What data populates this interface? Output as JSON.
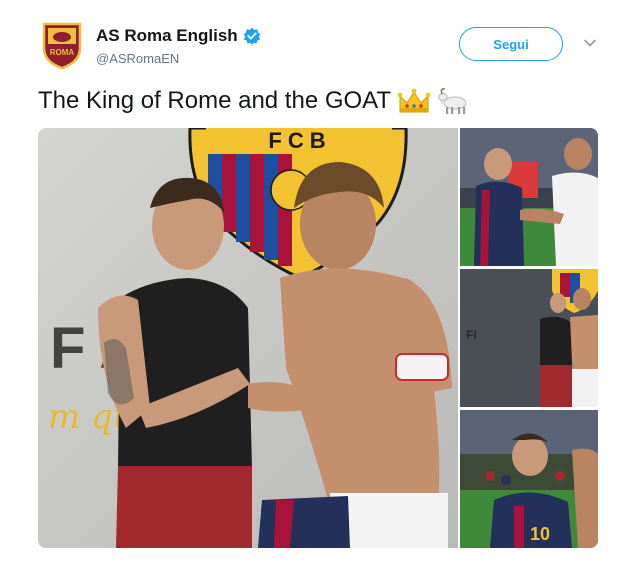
{
  "account": {
    "name": "AS Roma English",
    "handle": "@ASRomaEN",
    "avatar_text": "ROMA",
    "verified": true
  },
  "actions": {
    "follow_label": "Segui",
    "menu_icon": "chevron-down-icon"
  },
  "tweet": {
    "text": "The King of Rome and the GOAT",
    "emojis": [
      "crown-emoji",
      "goat-emoji"
    ]
  },
  "media": {
    "main_crest_text": "FCB",
    "wall_text": "F    ARC",
    "wall_slogan": "m   que u",
    "tiles": [
      "photo-tile-1",
      "photo-tile-2",
      "photo-tile-3"
    ]
  },
  "colors": {
    "accent": "#1da1f2",
    "roma_red": "#8e1f2f",
    "roma_gold": "#f0bc42"
  }
}
